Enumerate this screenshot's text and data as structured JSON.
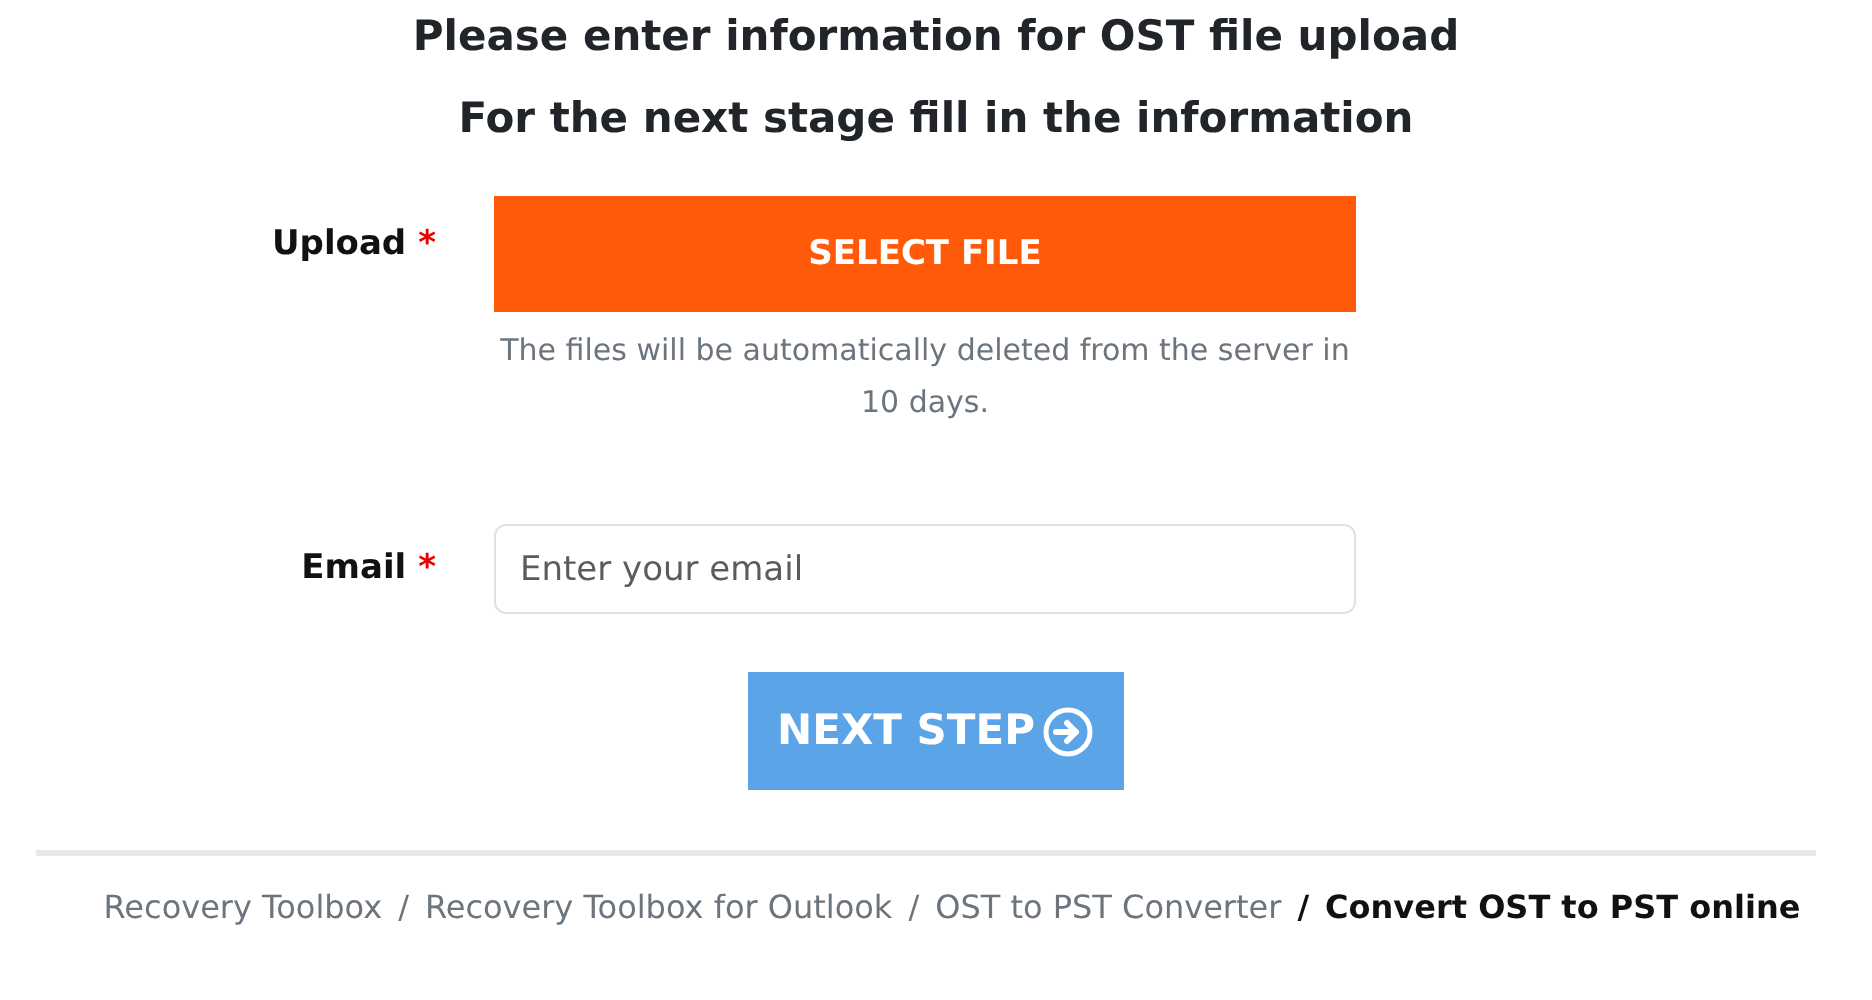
{
  "headings": [
    "Please enter information for OST file upload",
    "For the next stage fill in the information"
  ],
  "upload": {
    "label": "Upload",
    "required_mark": "*",
    "button": "SELECT FILE",
    "note": "The files will be automatically deleted from the server in 10 days."
  },
  "email": {
    "label": "Email",
    "required_mark": "*",
    "placeholder": "Enter your email"
  },
  "next_button": "NEXT STEP",
  "breadcrumb": [
    {
      "label": "Recovery Toolbox",
      "selected": false
    },
    {
      "label": "Recovery Toolbox for Outlook",
      "selected": false
    },
    {
      "label": "OST to PST Converter",
      "selected": false
    },
    {
      "label": "Convert OST to PST online",
      "selected": true
    }
  ],
  "breadcrumb_separator": "/"
}
